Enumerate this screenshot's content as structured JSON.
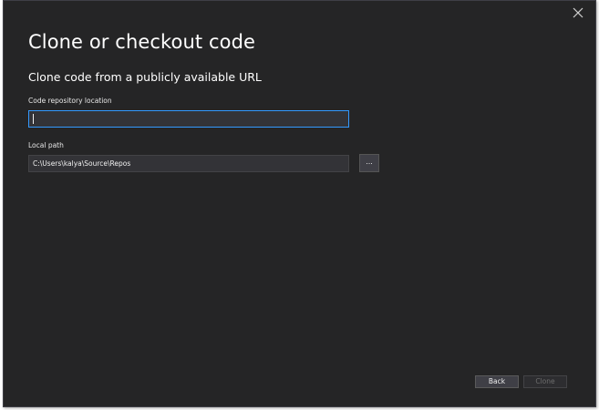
{
  "dialog": {
    "title": "Clone or checkout code",
    "subtitle": "Clone code from a publicly available URL",
    "close_icon": "close-icon"
  },
  "repository": {
    "label": "Code repository location",
    "value": ""
  },
  "local_path": {
    "label": "Local path",
    "value": "C:\\Users\\kalya\\Source\\Repos",
    "browse_label": "..."
  },
  "footer": {
    "back_label": "Back",
    "clone_label": "Clone"
  },
  "colors": {
    "background": "#252526",
    "focus_border": "#3399ff",
    "text": "#ffffff"
  }
}
